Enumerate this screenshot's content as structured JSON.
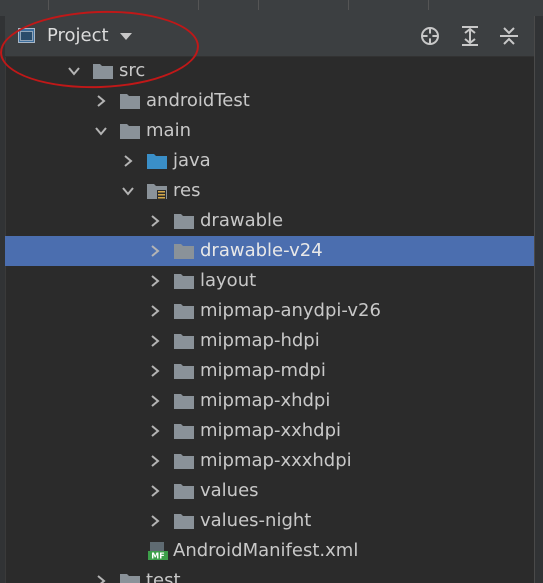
{
  "panel": {
    "title": "Project",
    "icons": {
      "project": "project-window-icon",
      "dropdown": "chevron-down-icon",
      "locate": "locate-target-icon",
      "expand_all": "expand-all-icon",
      "collapse_all": "collapse-all-icon"
    }
  },
  "annotation": {
    "type": "hand-drawn-circle",
    "color": "#c01818"
  },
  "colors": {
    "background": "#2b2b2b",
    "header": "#3c3f41",
    "selection": "#4b6eaf",
    "folder": "#8a9299",
    "source_folder": "#3a8fc8",
    "text": "#c8c8c8"
  },
  "tree": {
    "items": [
      {
        "label": "src",
        "depth": 0,
        "expanded": true,
        "icon": "folder-icon"
      },
      {
        "label": "androidTest",
        "depth": 1,
        "expanded": false,
        "icon": "folder-icon"
      },
      {
        "label": "main",
        "depth": 1,
        "expanded": true,
        "icon": "folder-icon"
      },
      {
        "label": "java",
        "depth": 2,
        "expanded": false,
        "icon": "source-folder-icon"
      },
      {
        "label": "res",
        "depth": 2,
        "expanded": true,
        "icon": "resource-folder-icon"
      },
      {
        "label": "drawable",
        "depth": 3,
        "expanded": false,
        "icon": "folder-icon"
      },
      {
        "label": "drawable-v24",
        "depth": 3,
        "expanded": false,
        "icon": "folder-icon",
        "selected": true
      },
      {
        "label": "layout",
        "depth": 3,
        "expanded": false,
        "icon": "folder-icon"
      },
      {
        "label": "mipmap-anydpi-v26",
        "depth": 3,
        "expanded": false,
        "icon": "folder-icon"
      },
      {
        "label": "mipmap-hdpi",
        "depth": 3,
        "expanded": false,
        "icon": "folder-icon"
      },
      {
        "label": "mipmap-mdpi",
        "depth": 3,
        "expanded": false,
        "icon": "folder-icon"
      },
      {
        "label": "mipmap-xhdpi",
        "depth": 3,
        "expanded": false,
        "icon": "folder-icon"
      },
      {
        "label": "mipmap-xxhdpi",
        "depth": 3,
        "expanded": false,
        "icon": "folder-icon"
      },
      {
        "label": "mipmap-xxxhdpi",
        "depth": 3,
        "expanded": false,
        "icon": "folder-icon"
      },
      {
        "label": "values",
        "depth": 3,
        "expanded": false,
        "icon": "folder-icon"
      },
      {
        "label": "values-night",
        "depth": 3,
        "expanded": false,
        "icon": "folder-icon"
      },
      {
        "label": "AndroidManifest.xml",
        "depth": 2,
        "expanded": null,
        "icon": "manifest-file-icon",
        "badge": "MF"
      },
      {
        "label": "test",
        "depth": 1,
        "expanded": false,
        "icon": "folder-icon"
      }
    ]
  }
}
